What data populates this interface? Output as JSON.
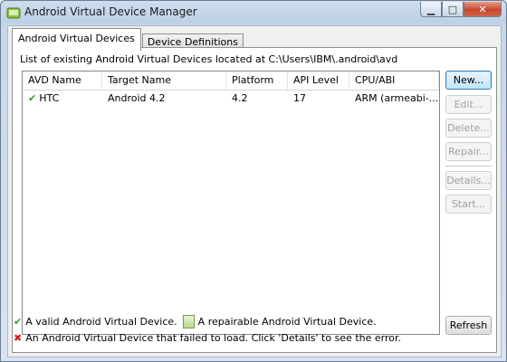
{
  "window": {
    "title": "Android Virtual Device Manager"
  },
  "tabs": [
    {
      "label": "Android Virtual Devices",
      "active": true
    },
    {
      "label": "Device Definitions",
      "active": false
    }
  ],
  "description": "List of existing Android Virtual Devices located at C:\\Users\\IBM\\.android\\avd",
  "table": {
    "columns": [
      "AVD Name",
      "Target Name",
      "Platform",
      "API Level",
      "CPU/ABI"
    ],
    "rows": [
      {
        "status_icon": "valid-check-icon",
        "avd_name": "HTC",
        "target_name": "Android 4.2",
        "platform": "4.2",
        "api_level": "17",
        "cpu_abi": "ARM (armeabi-..."
      }
    ]
  },
  "buttons": {
    "new": "New...",
    "edit": "Edit...",
    "delete": "Delete...",
    "repair": "Repair...",
    "details": "Details...",
    "start": "Start...",
    "refresh": "Refresh"
  },
  "legend": {
    "valid": "A valid Android Virtual Device.",
    "repairable": "A repairable Android Virtual Device.",
    "failed": "An Android Virtual Device that failed to load. Click 'Details' to see the error."
  },
  "colors": {
    "valid": "#2e9e28",
    "failed": "#d11a1a",
    "default_button": "#3c7fb1"
  }
}
